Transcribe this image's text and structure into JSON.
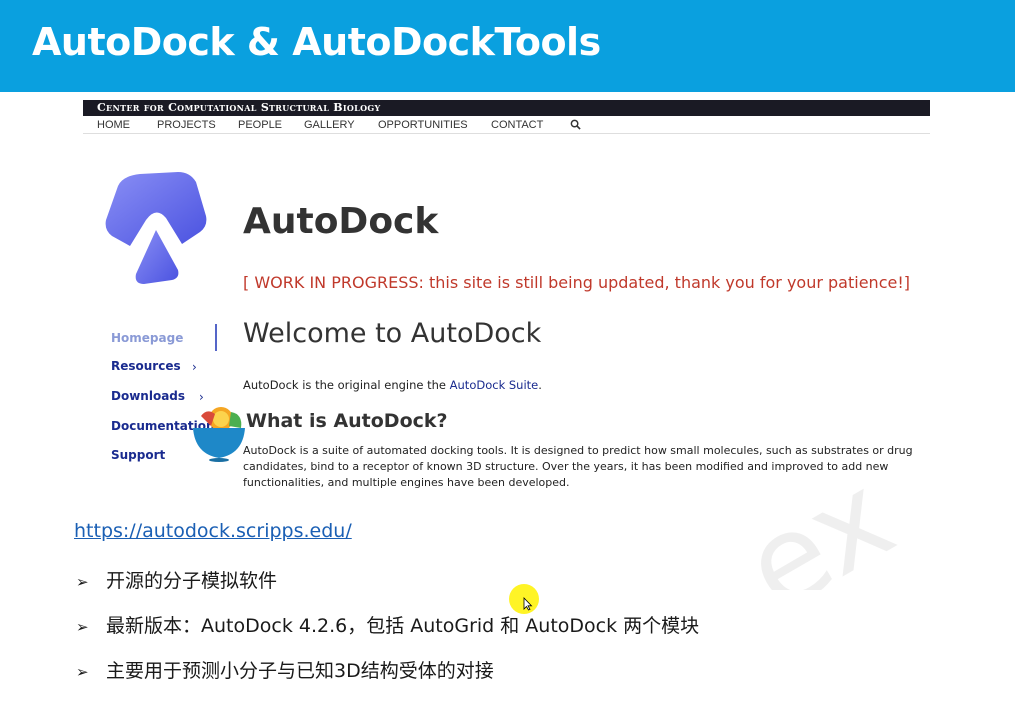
{
  "slide": {
    "title": "AutoDock & AutoDockTools",
    "url": "https://autodock.scripps.edu/",
    "bullets": [
      "开源的分子模拟软件",
      "最新版本：AutoDock 4.2.6，包括 AutoGrid 和 AutoDock 两个模块",
      "主要用于预测小分子与已知3D结构受体的对接"
    ],
    "bullet_symbol": "➢"
  },
  "site": {
    "banner": "Center for Computational Structural Biology",
    "nav": [
      "HOME",
      "PROJECTS",
      "PEOPLE",
      "GALLERY",
      "OPPORTUNITIES",
      "CONTACT"
    ],
    "heading": "AutoDock",
    "notice": "[ WORK IN PROGRESS: this site is still being updated, thank you for your patience!]",
    "sidebar": [
      {
        "label": "Homepage"
      },
      {
        "label": "Resources",
        "chevron": "›"
      },
      {
        "label": "Downloads",
        "chevron": "›"
      },
      {
        "label": "Documentation"
      },
      {
        "label": "Support"
      }
    ],
    "welcome": "Welcome to AutoDock",
    "intro_text": "AutoDock is the original engine the ",
    "intro_link": "AutoDock Suite",
    "intro_end": ".",
    "what_heading": "What is AutoDock?",
    "description_lines": [
      "AutoDock is a suite of automated docking tools. It is designed to predict how small molecules, such as substrates or drug",
      "candidates, bind to a receptor of known 3D structure. Over the years, it has been modified and improved to add new",
      "functionalities, and multiple engines have been developed."
    ]
  },
  "colors": {
    "header_bg": "#0aa0df",
    "notice": "#c0392b",
    "link": "#1a5fb4",
    "sidebar_link": "#1a2b8f",
    "cursor_highlight": "#fff200"
  },
  "icons": {
    "search": "search-icon",
    "logo": "autodock-logo",
    "overlay": "fruit-bowl-icon",
    "cursor": "mouse-cursor-icon"
  }
}
